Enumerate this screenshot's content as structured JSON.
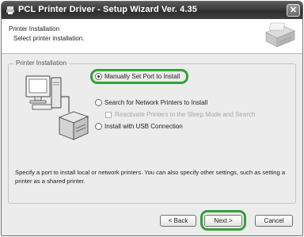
{
  "window": {
    "title": "PCL Printer Driver - Setup Wizard Ver. 4.35",
    "close_label": "✕"
  },
  "header": {
    "title": "Printer Installation",
    "subtitle": "Select printer installation."
  },
  "group": {
    "legend": "Printer Installation",
    "options": [
      {
        "label": "Manually Set Port to Install",
        "selected": true
      },
      {
        "label": "Search for Network Printers to Install",
        "selected": false
      },
      {
        "label": "Reactivate Printers in the Sleep Mode and Search",
        "enabled": false
      },
      {
        "label": "Install with USB Connection",
        "selected": false
      }
    ],
    "description": "Specify a port to install local or network printers. You can also specify other settings, such as setting a printer as a shared printer."
  },
  "buttons": {
    "back": "< Back",
    "next": "Next >",
    "cancel": "Cancel"
  },
  "colors": {
    "highlight": "#35a03a",
    "titlebar": "#3c3c3c"
  }
}
